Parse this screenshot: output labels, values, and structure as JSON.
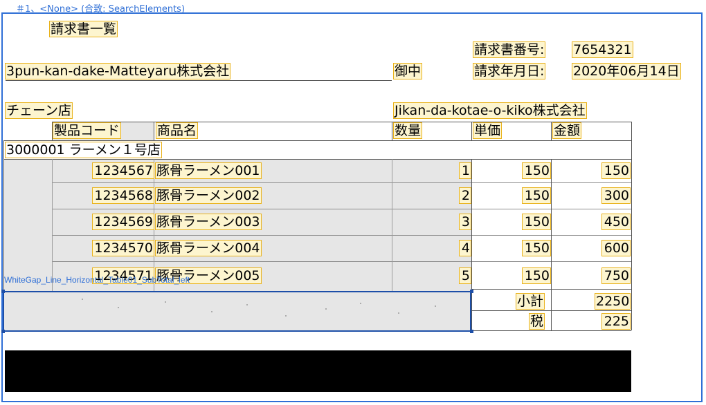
{
  "caption": "＃1、<None> (合致: SearchElements)",
  "overlay_label": "WhiteGap_Line_Horizontal_Table01_SubTotal_left",
  "doc": {
    "title": "請求書一覧",
    "invoice_no_label": "請求書番号:",
    "invoice_no": "7654321",
    "invoice_date_label": "請求年月日:",
    "invoice_date": "2020年06月14日",
    "customer": "3pun-kan-dake-Matteyaru株式会社",
    "honorific": "御中",
    "chain_label": "チェーン店",
    "issuer": "Jikan-da-kotae-o-kiko株式会社",
    "headers": {
      "code": "製品コード",
      "name": "商品名",
      "qty": "数量",
      "unit": "単価",
      "amount": "金額"
    },
    "store": "3000001 ラーメン１号店",
    "rows": [
      {
        "code": "1234567",
        "name": "豚骨ラーメン001",
        "qty": "1",
        "unit": "150",
        "amount": "150"
      },
      {
        "code": "1234568",
        "name": "豚骨ラーメン002",
        "qty": "2",
        "unit": "150",
        "amount": "300"
      },
      {
        "code": "1234569",
        "name": "豚骨ラーメン003",
        "qty": "3",
        "unit": "150",
        "amount": "450"
      },
      {
        "code": "1234570",
        "name": "豚骨ラーメン004",
        "qty": "4",
        "unit": "150",
        "amount": "600"
      },
      {
        "code": "1234571",
        "name": "豚骨ラーメン005",
        "qty": "5",
        "unit": "150",
        "amount": "750"
      }
    ],
    "subtotal_label": "小計",
    "subtotal": "2250",
    "tax_label": "税",
    "tax": "225"
  }
}
